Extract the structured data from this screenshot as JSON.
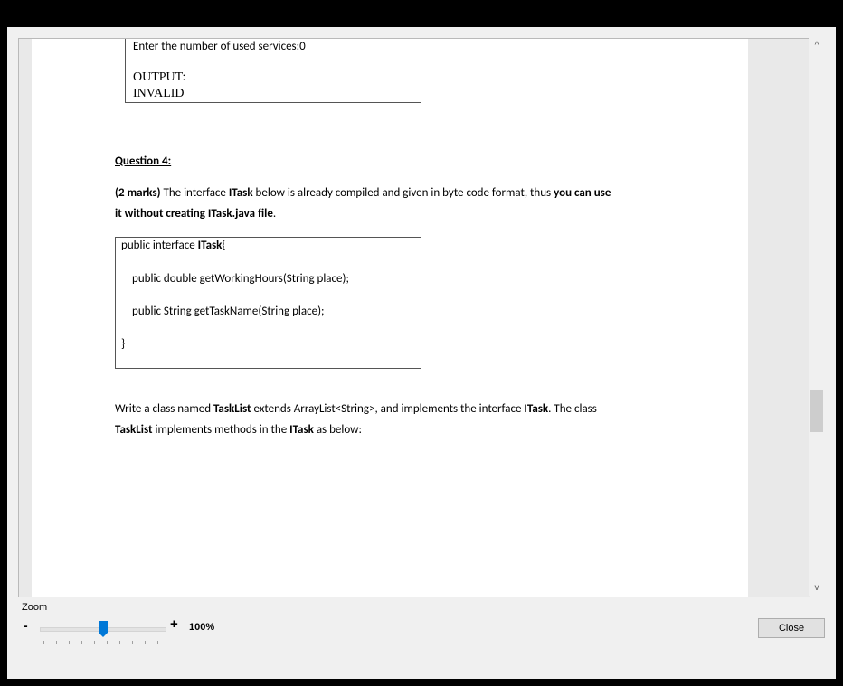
{
  "box_top": {
    "line1": "Enter the number of used services:0",
    "output_label": "OUTPUT:",
    "output_value": "INVALID"
  },
  "question": {
    "title": "Question 4:",
    "intro_bold": "(2 marks)",
    "intro_a": " The interface ",
    "intro_itask": "ITask",
    "intro_b": " below is already compiled and given in byte code format, thus ",
    "intro_bold2": "you can use",
    "intro_line2_bold": "it without creating ITask.java file",
    "intro_line2_end": "."
  },
  "code": {
    "line1_a": "public interface ",
    "line1_b": "ITask",
    "line1_c": "{",
    "line2": "public double getWorkingHours(String place);",
    "line3": "public String getTaskName(String place);",
    "line4": "}"
  },
  "task": {
    "a": "Write a class named ",
    "b": "TaskList",
    "c": " extends ArrayList<String>, and implements the interface ",
    "d": "ITask",
    "e": ". The class",
    "f": "TaskList",
    "g": " implements methods  in the ",
    "h": "ITask",
    "i": " as below:"
  },
  "zoom": {
    "label": "Zoom",
    "minus": "-",
    "plus": "+",
    "value": "100%",
    "level_percent": 100
  },
  "scrollbar": {
    "up": "^",
    "down": "v"
  },
  "close_button": "Close"
}
